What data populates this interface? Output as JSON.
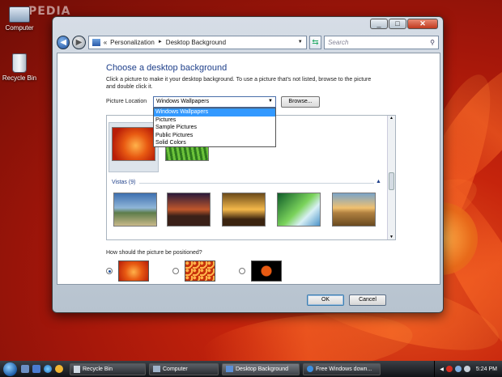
{
  "desktop": {
    "watermark": "PEDIA",
    "icons": [
      {
        "label": "Computer"
      },
      {
        "label": "Recycle Bin"
      }
    ]
  },
  "window": {
    "breadcrumb": {
      "prefix": "«",
      "parts": [
        "Personalization",
        "Desktop Background"
      ],
      "sep": "►"
    },
    "search_placeholder": "Search",
    "title": "Choose a desktop background",
    "description": "Click a picture to make it your desktop background. To use a picture that's not listed, browse to the picture and double click it.",
    "location_label": "Picture Location",
    "location_value": "Windows Wallpapers",
    "browse_label": "Browse...",
    "dropdown_options": [
      "Windows Wallpapers",
      "Pictures",
      "Sample Pictures",
      "Public Pictures",
      "Solid Colors"
    ],
    "group_label": "Vistas (9)",
    "position_label": "How should the picture be positioned?",
    "ok_label": "OK",
    "cancel_label": "Cancel"
  },
  "taskbar": {
    "tasks": [
      "Recycle Bin",
      "Computer",
      "Desktop Background",
      "Free Windows down..."
    ],
    "clock": "5:24 PM"
  },
  "colors": {
    "accent": "#1e3f8a",
    "selection": "#3399ff",
    "desktop": "#c6240c"
  }
}
